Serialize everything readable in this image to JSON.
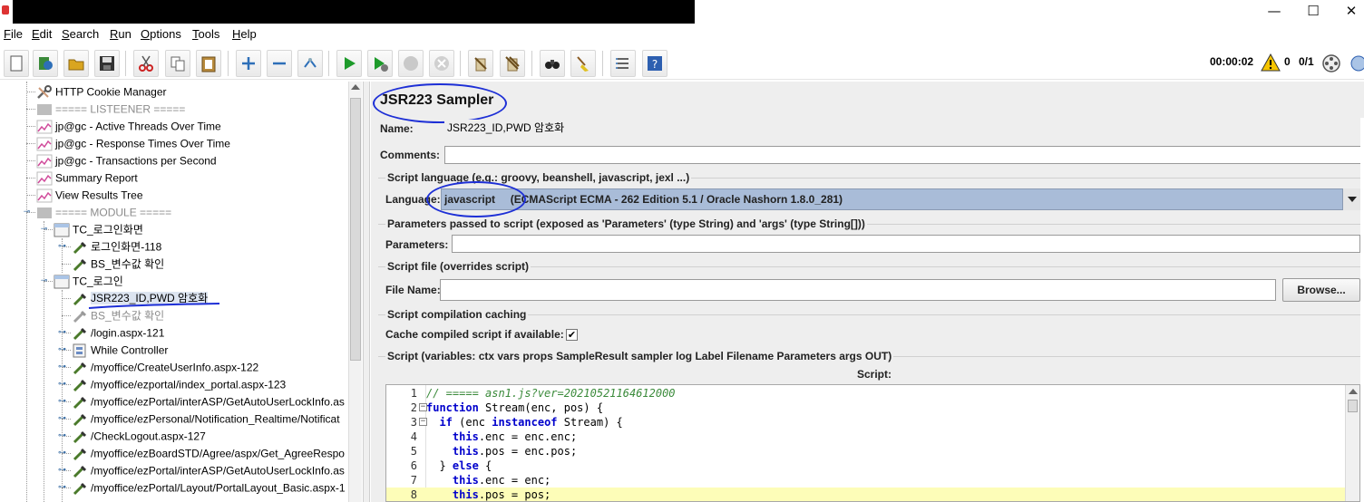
{
  "window": {
    "minimize": "—",
    "maximize": "☐",
    "close": "✕"
  },
  "menu": [
    "File",
    "Edit",
    "Search",
    "Run",
    "Options",
    "Tools",
    "Help"
  ],
  "status": {
    "elapsed": "00:00:02",
    "warnings": "0",
    "threads": "0/1"
  },
  "tree": {
    "items": [
      {
        "label": "HTTP Cookie Manager",
        "icon": "wrench-icon",
        "state": "normal"
      },
      {
        "label": "===== LISTEENER =====",
        "icon": "disabled-element-icon",
        "state": "disabled"
      },
      {
        "label": "jp@gc - Active Threads Over Time",
        "icon": "graph-listener-icon",
        "state": "normal"
      },
      {
        "label": "jp@gc - Response Times Over Time",
        "icon": "graph-listener-icon",
        "state": "normal"
      },
      {
        "label": "jp@gc - Transactions per Second",
        "icon": "graph-listener-icon",
        "state": "normal"
      },
      {
        "label": "Summary Report",
        "icon": "graph-listener-icon",
        "state": "normal"
      },
      {
        "label": "View Results Tree",
        "icon": "graph-listener-icon",
        "state": "normal"
      },
      {
        "label": "===== MODULE =====",
        "icon": "disabled-element-icon",
        "state": "disabled"
      },
      {
        "label": "TC_로그인화면",
        "icon": "test-fragment-icon",
        "state": "normal"
      },
      {
        "label": "로그인화면-118",
        "icon": "sampler-pipette-icon",
        "state": "normal"
      },
      {
        "label": "BS_변수값 확인",
        "icon": "sampler-pipette-icon",
        "state": "normal"
      },
      {
        "label": "TC_로그인",
        "icon": "test-fragment-icon",
        "state": "normal"
      },
      {
        "label": "JSR223_ID,PWD 암호화",
        "icon": "sampler-pipette-icon",
        "state": "selected"
      },
      {
        "label": "BS_변수값 확인",
        "icon": "sampler-pipette-icon",
        "state": "disabled"
      },
      {
        "label": "/login.aspx-121",
        "icon": "sampler-pipette-icon",
        "state": "normal"
      },
      {
        "label": "While Controller",
        "icon": "controller-icon",
        "state": "normal"
      },
      {
        "label": "/myoffice/CreateUserInfo.aspx-122",
        "icon": "sampler-pipette-icon",
        "state": "normal"
      },
      {
        "label": "/myoffice/ezportal/index_portal.aspx-123",
        "icon": "sampler-pipette-icon",
        "state": "normal"
      },
      {
        "label": "/myoffice/ezPortal/interASP/GetAutoUserLockInfo.as",
        "icon": "sampler-pipette-icon",
        "state": "normal"
      },
      {
        "label": "/myoffice/ezPersonal/Notification_Realtime/Notificat",
        "icon": "sampler-pipette-icon",
        "state": "normal"
      },
      {
        "label": "/CheckLogout.aspx-127",
        "icon": "sampler-pipette-icon",
        "state": "normal"
      },
      {
        "label": "/myoffice/ezBoardSTD/Agree/aspx/Get_AgreeRespo",
        "icon": "sampler-pipette-icon",
        "state": "normal"
      },
      {
        "label": "/myoffice/ezPortal/interASP/GetAutoUserLockInfo.as",
        "icon": "sampler-pipette-icon",
        "state": "normal"
      },
      {
        "label": "/myoffice/ezPortal/Layout/PortalLayout_Basic.aspx-1",
        "icon": "sampler-pipette-icon",
        "state": "normal"
      }
    ]
  },
  "panel": {
    "title": "JSR223 Sampler",
    "name_label": "Name:",
    "name_value": "JSR223_ID,PWD 암호화",
    "comments_label": "Comments:",
    "comments_value": "",
    "lang_group": "Script language (e.g.: groovy, beanshell, javascript, jexl ...)",
    "lang_label": "Language:",
    "lang_value": "javascript     (ECMAScript ECMA - 262 Edition 5.1 / Oracle Nashorn 1.8.0_281)",
    "params_group": "Parameters passed to script (exposed as 'Parameters' (type String) and 'args' (type String[]))",
    "params_label": "Parameters:",
    "params_value": "",
    "file_group": "Script file (overrides script)",
    "file_label": "File Name:",
    "file_value": "",
    "browse": "Browse...",
    "cache_group": "Script compilation caching",
    "cache_label": "Cache compiled script if available:",
    "cache_checked": "✔",
    "script_group": "Script (variables: ctx vars props SampleResult sampler log Label Filename Parameters args OUT)",
    "script_label": "Script:"
  },
  "code": {
    "lines": [
      {
        "n": "1",
        "fold": "",
        "text": "// ===== asn1.js?ver=20210521164612000"
      },
      {
        "n": "2",
        "fold": "−",
        "text": "function Stream(enc, pos) {"
      },
      {
        "n": "3",
        "fold": "−",
        "text": "  if (enc instanceof Stream) {"
      },
      {
        "n": "4",
        "fold": "",
        "text": "    this.enc = enc.enc;"
      },
      {
        "n": "5",
        "fold": "",
        "text": "    this.pos = enc.pos;"
      },
      {
        "n": "6",
        "fold": "",
        "text": "  } else {"
      },
      {
        "n": "7",
        "fold": "",
        "text": "    this.enc = enc;"
      },
      {
        "n": "8",
        "fold": "",
        "text": "    this.pos = pos;"
      }
    ],
    "current_line": "8"
  }
}
